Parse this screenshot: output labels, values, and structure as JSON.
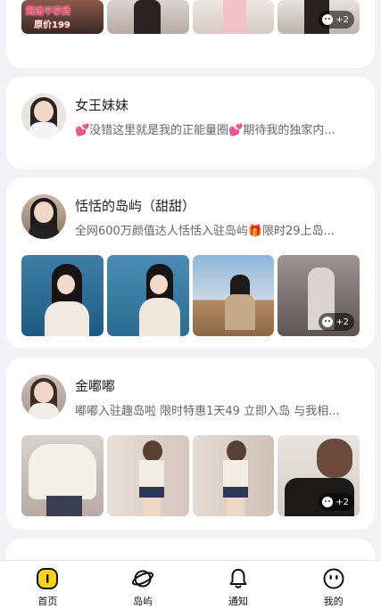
{
  "feed": {
    "top_card": {
      "promo_tag": "限进平享受",
      "promo_price": "原价199",
      "more_count": "+2"
    },
    "posts": [
      {
        "name": "女王妹妹",
        "desc": "💕没错这里就是我的正能量圈💕期待我的独家内..."
      },
      {
        "name": "恬恬的岛屿（甜甜）",
        "desc": "全网600万颜值达人恬恬入驻岛屿🎁限时29上岛...",
        "more_count": "+2"
      },
      {
        "name": "金嘟嘟",
        "desc": "嘟嘟入驻趣岛啦 限时特惠1天49 立即入岛 与我相...",
        "more_count": "+2"
      }
    ]
  },
  "tabbar": {
    "items": [
      {
        "label": "首页",
        "icon": "home-icon"
      },
      {
        "label": "岛屿",
        "icon": "planet-icon"
      },
      {
        "label": "通知",
        "icon": "bell-icon"
      },
      {
        "label": "我的",
        "icon": "smiley-icon"
      }
    ],
    "active_color": "#ffd31a"
  }
}
